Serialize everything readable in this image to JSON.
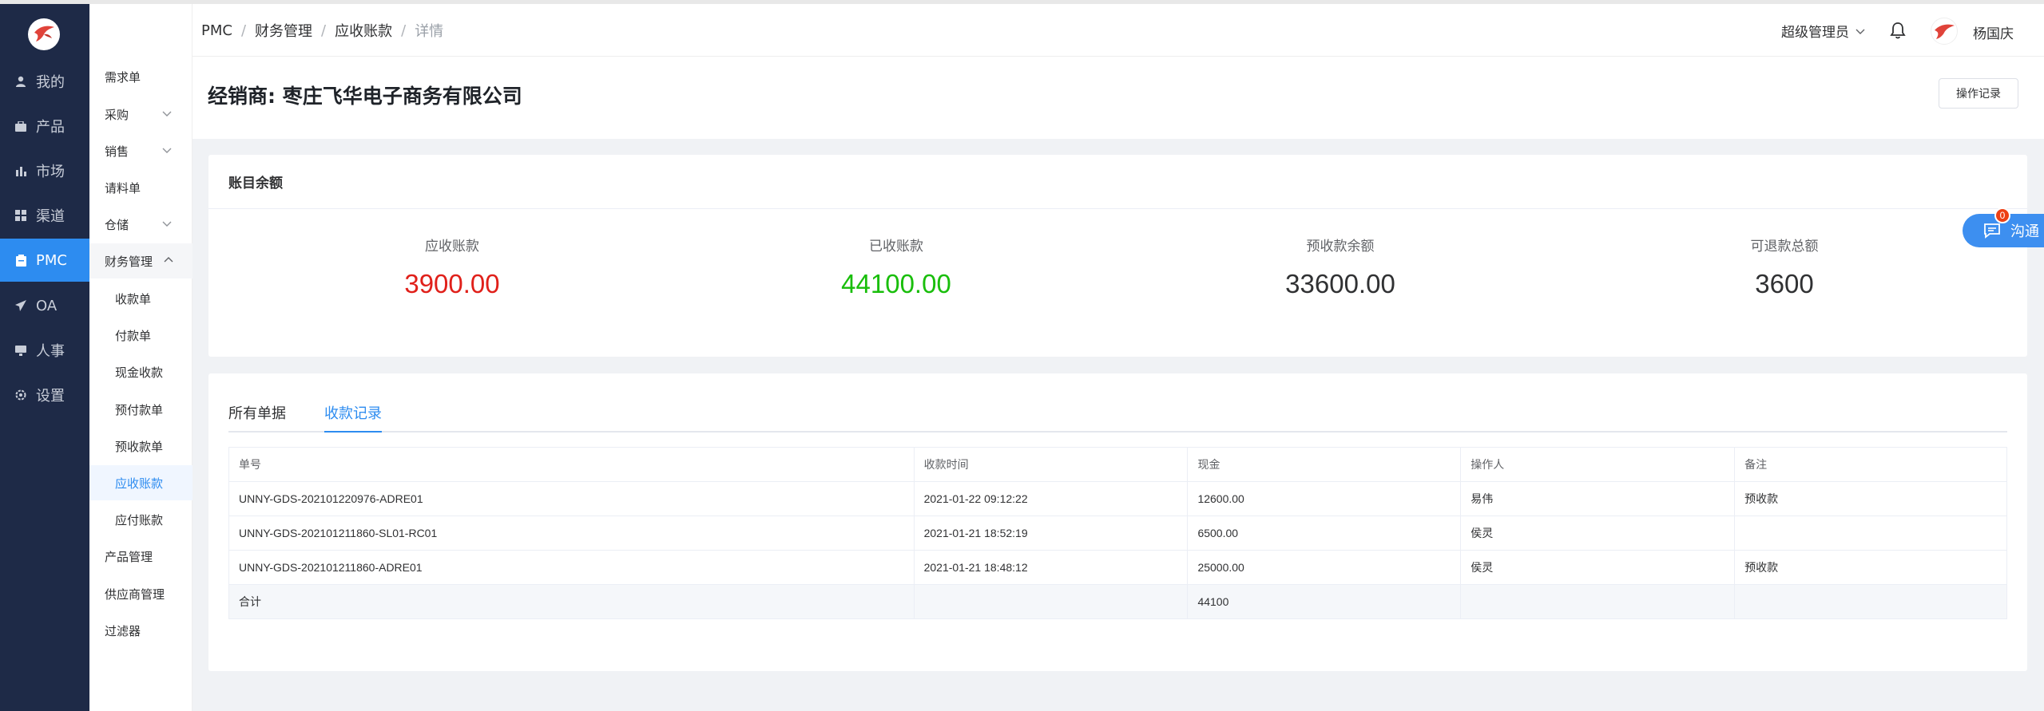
{
  "sidebar": {
    "items": [
      {
        "label": "我的",
        "icon": "user-icon"
      },
      {
        "label": "产品",
        "icon": "briefcase-icon"
      },
      {
        "label": "市场",
        "icon": "bar-chart-icon"
      },
      {
        "label": "渠道",
        "icon": "grid-icon"
      },
      {
        "label": "PMC",
        "icon": "clipboard-icon"
      },
      {
        "label": "OA",
        "icon": "send-icon"
      },
      {
        "label": "人事",
        "icon": "monitor-icon"
      },
      {
        "label": "设置",
        "icon": "gear-icon"
      }
    ],
    "active": "PMC"
  },
  "subnav": {
    "items": [
      "需求单",
      "采购",
      "销售",
      "请料单",
      "仓储",
      "财务管理",
      "收款单",
      "付款单",
      "现金收款",
      "预付款单",
      "预收款单",
      "应收账款",
      "应付账款",
      "产品管理",
      "供应商管理",
      "过滤器"
    ]
  },
  "header": {
    "breadcrumb": [
      "PMC",
      "财务管理",
      "应收账款",
      "详情"
    ],
    "breadcrumb_sep": "/",
    "role": "超级管理员",
    "username": "杨国庆"
  },
  "page": {
    "title": "经销商: 枣庄飞华电子商务有限公司",
    "op_button": "操作记录"
  },
  "balance": {
    "title": "账目余额",
    "stats": [
      {
        "label": "应收账款",
        "value": "3900.00",
        "color": "#e0201a"
      },
      {
        "label": "已收账款",
        "value": "44100.00",
        "color": "#19be0b"
      },
      {
        "label": "预收款余额",
        "value": "33600.00",
        "color": "#303133"
      },
      {
        "label": "可退款总额",
        "value": "3600",
        "color": "#303133"
      }
    ]
  },
  "records": {
    "tabs": [
      "所有单据",
      "收款记录"
    ],
    "active_tab": "收款记录",
    "columns": [
      "单号",
      "收款时间",
      "现金",
      "操作人",
      "备注"
    ],
    "rows": [
      [
        "UNNY-GDS-202101220976-ADRE01",
        "2021-01-22 09:12:22",
        "12600.00",
        "易伟",
        "预收款"
      ],
      [
        "UNNY-GDS-202101211860-SL01-RC01",
        "2021-01-21 18:52:19",
        "6500.00",
        "侯灵",
        ""
      ],
      [
        "UNNY-GDS-202101211860-ADRE01",
        "2021-01-21 18:48:12",
        "25000.00",
        "侯灵",
        "预收款"
      ]
    ],
    "total_row": [
      "合计",
      "",
      "44100",
      "",
      ""
    ]
  },
  "chat": {
    "label": "沟通",
    "badge": "0"
  }
}
